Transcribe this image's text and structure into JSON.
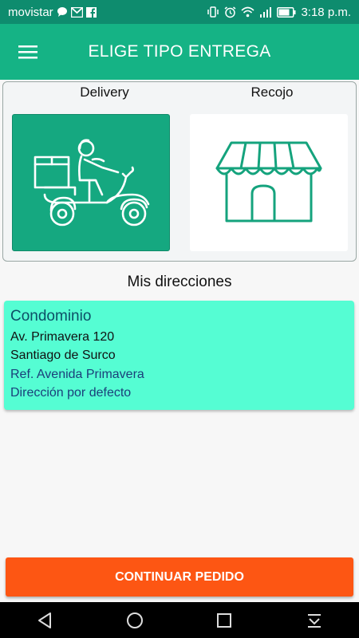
{
  "status_bar": {
    "carrier": "movistar",
    "time": "3:18 p.m.",
    "left_icons": [
      "chat-bubble-icon",
      "gmail-icon",
      "facebook-icon"
    ],
    "right_icons": [
      "vibrate-icon",
      "alarm-icon",
      "wifi-icon",
      "signal-icon",
      "battery-icon"
    ]
  },
  "app_bar": {
    "title": "ELIGE TIPO ENTREGA",
    "menu_icon": "hamburger-menu-icon",
    "color": "#15b385"
  },
  "delivery_type": {
    "options": [
      {
        "label": "Delivery",
        "icon": "delivery-scooter-icon",
        "selected": true
      },
      {
        "label": "Recojo",
        "icon": "storefront-icon",
        "selected": false
      }
    ]
  },
  "addresses": {
    "title": "Mis direcciones",
    "items": [
      {
        "name": "Condominio",
        "street": "Av. Primavera 120",
        "district": "Santiago de Surco",
        "reference": "Ref. Avenida Primavera",
        "default_label": "Dirección por defecto"
      }
    ]
  },
  "actions": {
    "continue_label": "CONTINUAR PEDIDO"
  },
  "colors": {
    "primary": "#15b385",
    "address_card": "#55fdd3",
    "cta": "#fd5613"
  },
  "nav_bar": {
    "buttons": [
      "back-icon",
      "home-icon",
      "recents-icon",
      "notification-drawer-icon"
    ]
  }
}
